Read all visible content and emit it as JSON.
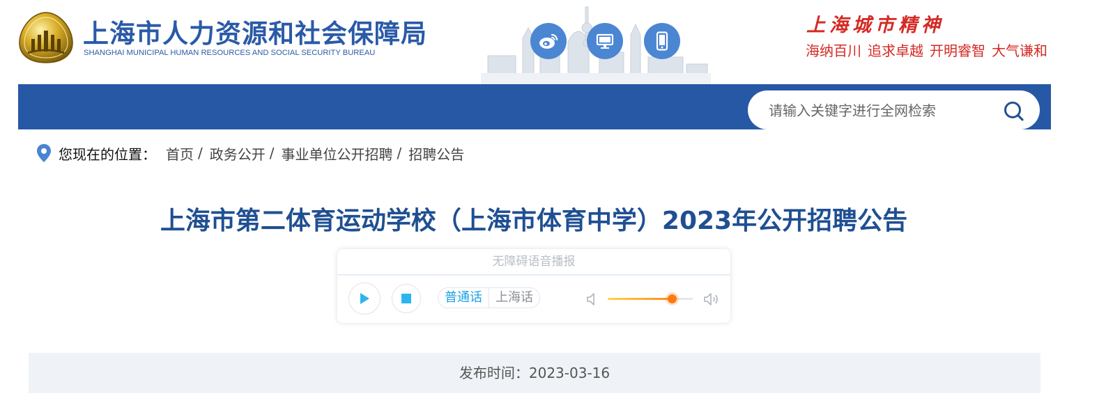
{
  "header": {
    "site_title_cn": "上海市人力资源和社会保障局",
    "site_title_en": "SHANGHAI MUNICIPAL HUMAN RESOURCES AND SOCIAL SECURITY BUREAU",
    "icons": [
      "weibo-icon",
      "monitor-icon",
      "mobile-icon"
    ],
    "spirit": {
      "title": "上海城市精神",
      "slogans": [
        "海纳百川",
        "追求卓越",
        "开明睿智",
        "大气谦和"
      ]
    }
  },
  "search": {
    "placeholder": "请输入关键字进行全网检索",
    "value": ""
  },
  "breadcrumb": {
    "label": "您现在的位置：",
    "items": [
      "首页",
      "政务公开",
      "事业单位公开招聘",
      "招聘公告"
    ],
    "separator": "/"
  },
  "article": {
    "title": "上海市第二体育运动学校（上海市体育中学）2023年公开招聘公告",
    "publish_label": "发布时间：",
    "publish_date": "2023-03-16"
  },
  "player": {
    "header": "无障碍语音播报",
    "languages": [
      "普通话",
      "上海话"
    ],
    "active_language": "普通话",
    "volume": 0.75
  },
  "colors": {
    "brand_blue": "#2658a5",
    "title_blue": "#1f4f92",
    "accent_red": "#d42a24",
    "player_accent": "#1aa1e6",
    "volume_orange": "#ff7a12"
  }
}
